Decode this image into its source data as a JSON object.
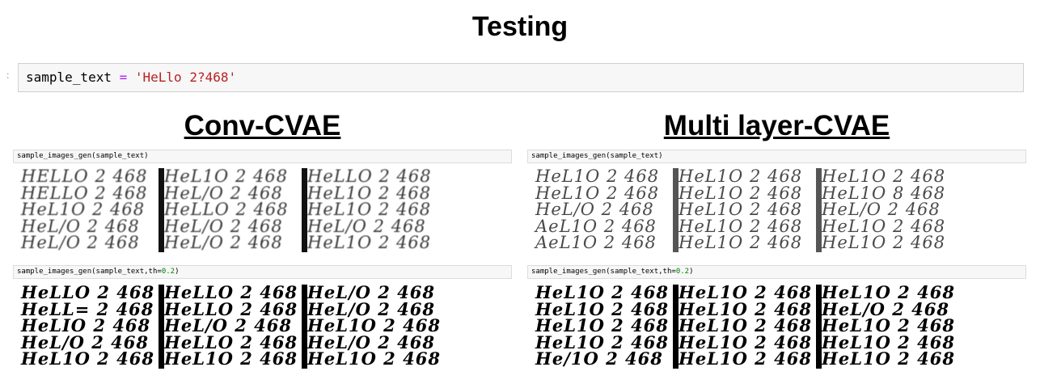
{
  "page_title": "Testing",
  "input_cell": {
    "variable": "sample_text",
    "operator": "=",
    "value": "'HeLlo 2?468'"
  },
  "sections": [
    {
      "title": "Conv-CVAE",
      "cell1": {
        "fn": "sample_images_gen(sample_text)"
      },
      "cell2": {
        "pre": "sample_images_gen(sample_text,th=",
        "num": "0.2",
        "post": ")"
      },
      "grid1": {
        "style": "gray",
        "panels": [
          [
            "HELLO 2 468",
            "HELLO 2 468",
            "HeL1O 2 468",
            "HeL/O 2 468",
            "HeL/O 2 468"
          ],
          [
            "HeL1O 2 468",
            "HeL/O 2 468",
            "HeLLO 2 468",
            "HeL/O 2 468",
            "HeL/O 2 468"
          ],
          [
            "HeLLO 2 468",
            "HeL1O 2 468",
            "HeL1O 2 468",
            "HeL/O 2 468",
            "HeL1O 2 468"
          ]
        ]
      },
      "grid2": {
        "style": "bold",
        "panels": [
          [
            "HeLLO 2 468",
            "HeLL= 2 468",
            "HeLIO 2 468",
            "HeL/O 2 468",
            "HeL1O 2 468"
          ],
          [
            "HeLLO 2 468",
            "HeLLO 2 468",
            "HeL/O 2 468",
            "HeLLO 2 468",
            "HeL1O 2 468"
          ],
          [
            "HeL/O 2 468",
            "HeL/O 2 468",
            "HeL1O 2 468",
            "HeL/O 2 468",
            "HeL1O 2 468"
          ]
        ]
      }
    },
    {
      "title": "Multi layer-CVAE",
      "cell1": {
        "fn": "sample_images_gen(sample_text)"
      },
      "cell2": {
        "pre": "sample_images_gen(sample_text,th=",
        "num": "0.2",
        "post": ")"
      },
      "grid1": {
        "style": "light",
        "panels": [
          [
            "HeL1O 2 468",
            "HeL1O 2 468",
            "HeL/O 2 468",
            "AeL1O 2 468",
            "AeL1O 2 468"
          ],
          [
            "HeL1O 2 468",
            "HeL1O 2 468",
            "HeL1O 2 468",
            "HeL1O 2 468",
            "HeL1O 2 468"
          ],
          [
            "HeL1O 2 468",
            "HeL1O 8 468",
            "HeL/O 2 468",
            "HeL1O 2 468",
            "HeL1O 2 468"
          ]
        ]
      },
      "grid2": {
        "style": "bold",
        "panels": [
          [
            "HeL1O 2 468",
            "HeL1O 2 468",
            "HeL1O 2 468",
            "HeL1O 2 468",
            "He/1O 2 468"
          ],
          [
            "HeL1O 2 468",
            "HeL1O 2 468",
            "HeL1O 2 468",
            "HeL1O 2 468",
            "HeL1O 2 468"
          ],
          [
            "HeL1O 2 468",
            "HeL/O 2 468",
            "HeL1O 2 468",
            "HeL1O 2 468",
            "HeL1O 2 468"
          ]
        ]
      }
    }
  ]
}
